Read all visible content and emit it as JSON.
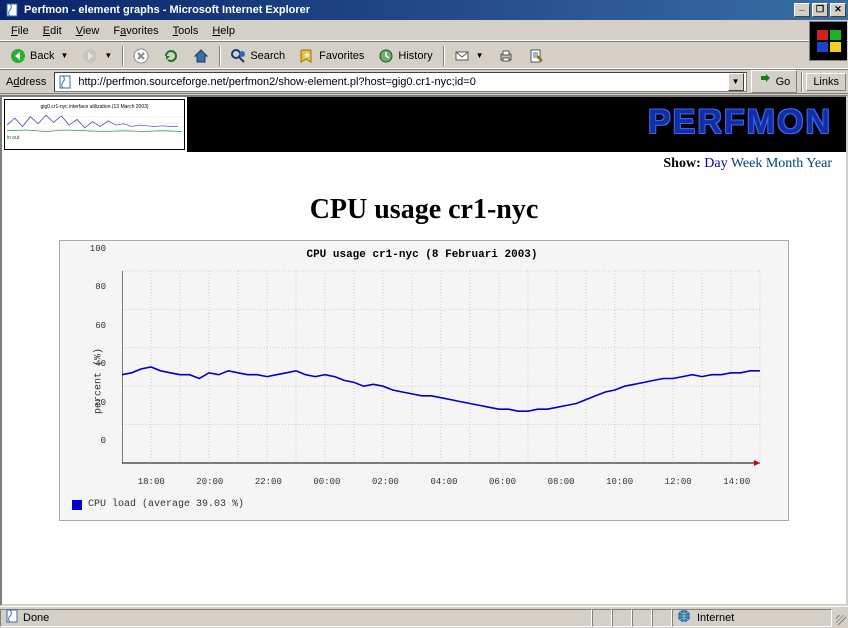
{
  "window": {
    "title": "Perfmon - element graphs - Microsoft Internet Explorer"
  },
  "menu": {
    "file": "File",
    "edit": "Edit",
    "view": "View",
    "favorites": "Favorites",
    "tools": "Tools",
    "help": "Help"
  },
  "toolbar": {
    "back": "Back",
    "search": "Search",
    "favorites": "Favorites",
    "history": "History"
  },
  "addressbar": {
    "label": "Address",
    "url": "http://perfmon.sourceforge.net/perfmon2/show-element.pl?host=gig0.cr1-nyc;id=0",
    "go": "Go",
    "links": "Links"
  },
  "page": {
    "logo": "PERFMON",
    "show_label": "Show:",
    "ranges": {
      "day": "Day",
      "week": "Week",
      "month": "Month",
      "year": "Year"
    },
    "active_range": "day",
    "heading": "CPU usage cr1-nyc",
    "legend_text": "CPU load  (average 39.03 %)"
  },
  "statusbar": {
    "status": "Done",
    "zone": "Internet"
  },
  "chart_data": {
    "type": "line",
    "title": "CPU usage cr1-nyc (8 Februari 2003)",
    "ylabel": "percent (%)",
    "xlabel": "",
    "ylim": [
      0,
      100
    ],
    "yticks": [
      0,
      20,
      40,
      60,
      80,
      100
    ],
    "x_categories": [
      "18:00",
      "20:00",
      "22:00",
      "00:00",
      "02:00",
      "04:00",
      "06:00",
      "08:00",
      "10:00",
      "12:00",
      "14:00"
    ],
    "series": [
      {
        "name": "CPU load",
        "color": "#0000cc",
        "values": [
          46,
          47,
          49,
          50,
          48,
          47,
          46,
          46,
          44,
          47,
          46,
          48,
          47,
          46,
          46,
          45,
          46,
          47,
          48,
          46,
          45,
          46,
          45,
          43,
          42,
          40,
          41,
          40,
          38,
          37,
          36,
          35,
          35,
          34,
          33,
          32,
          31,
          30,
          29,
          28,
          28,
          27,
          27,
          28,
          28,
          29,
          30,
          31,
          33,
          35,
          37,
          38,
          40,
          41,
          42,
          43,
          44,
          44,
          45,
          46,
          45,
          46,
          46,
          47,
          47,
          48,
          48
        ]
      }
    ],
    "average": 39.03,
    "units": "%"
  },
  "thumb_chart": {
    "title": "gig0.cr1-nyc interface utilization (13 March 2003)",
    "legend": "in  out"
  }
}
